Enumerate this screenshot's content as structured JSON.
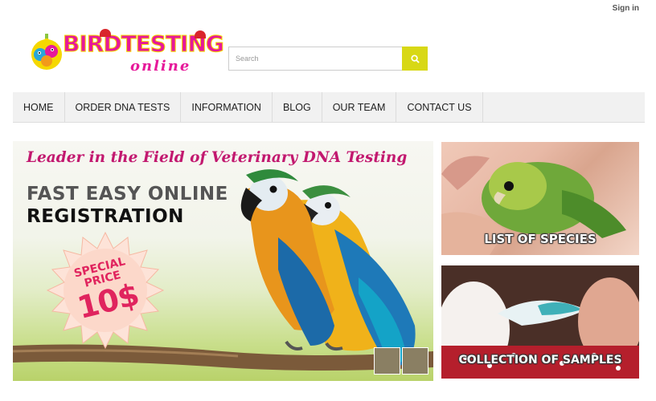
{
  "header": {
    "signin_label": "Sign in",
    "logo": {
      "word1": "BIRD",
      "word2": "TESTING",
      "tagline": "online"
    },
    "search": {
      "placeholder": "Search",
      "button_icon": "search-icon"
    }
  },
  "nav": {
    "items": [
      {
        "label": "HOME"
      },
      {
        "label": "ORDER DNA TESTS"
      },
      {
        "label": "INFORMATION"
      },
      {
        "label": "BLOG"
      },
      {
        "label": "OUR TEAM"
      },
      {
        "label": "CONTACT US"
      }
    ]
  },
  "hero": {
    "headline": "Leader in the Field of Veterinary DNA Testing",
    "line1": "FAST EASY ONLINE",
    "line2": "REGISTRATION",
    "badge_line1": "SPECIAL",
    "badge_line2": "PRICE",
    "badge_price": "10$"
  },
  "panels": {
    "species_label": "LIST OF SPECIES",
    "samples_label": "COLLECTION OF SAMPLES"
  },
  "colors": {
    "brand_pink": "#e6189a",
    "brand_yellow": "#d8d815",
    "nav_bg": "#f1f1f1",
    "headline_pink": "#c2186f"
  }
}
